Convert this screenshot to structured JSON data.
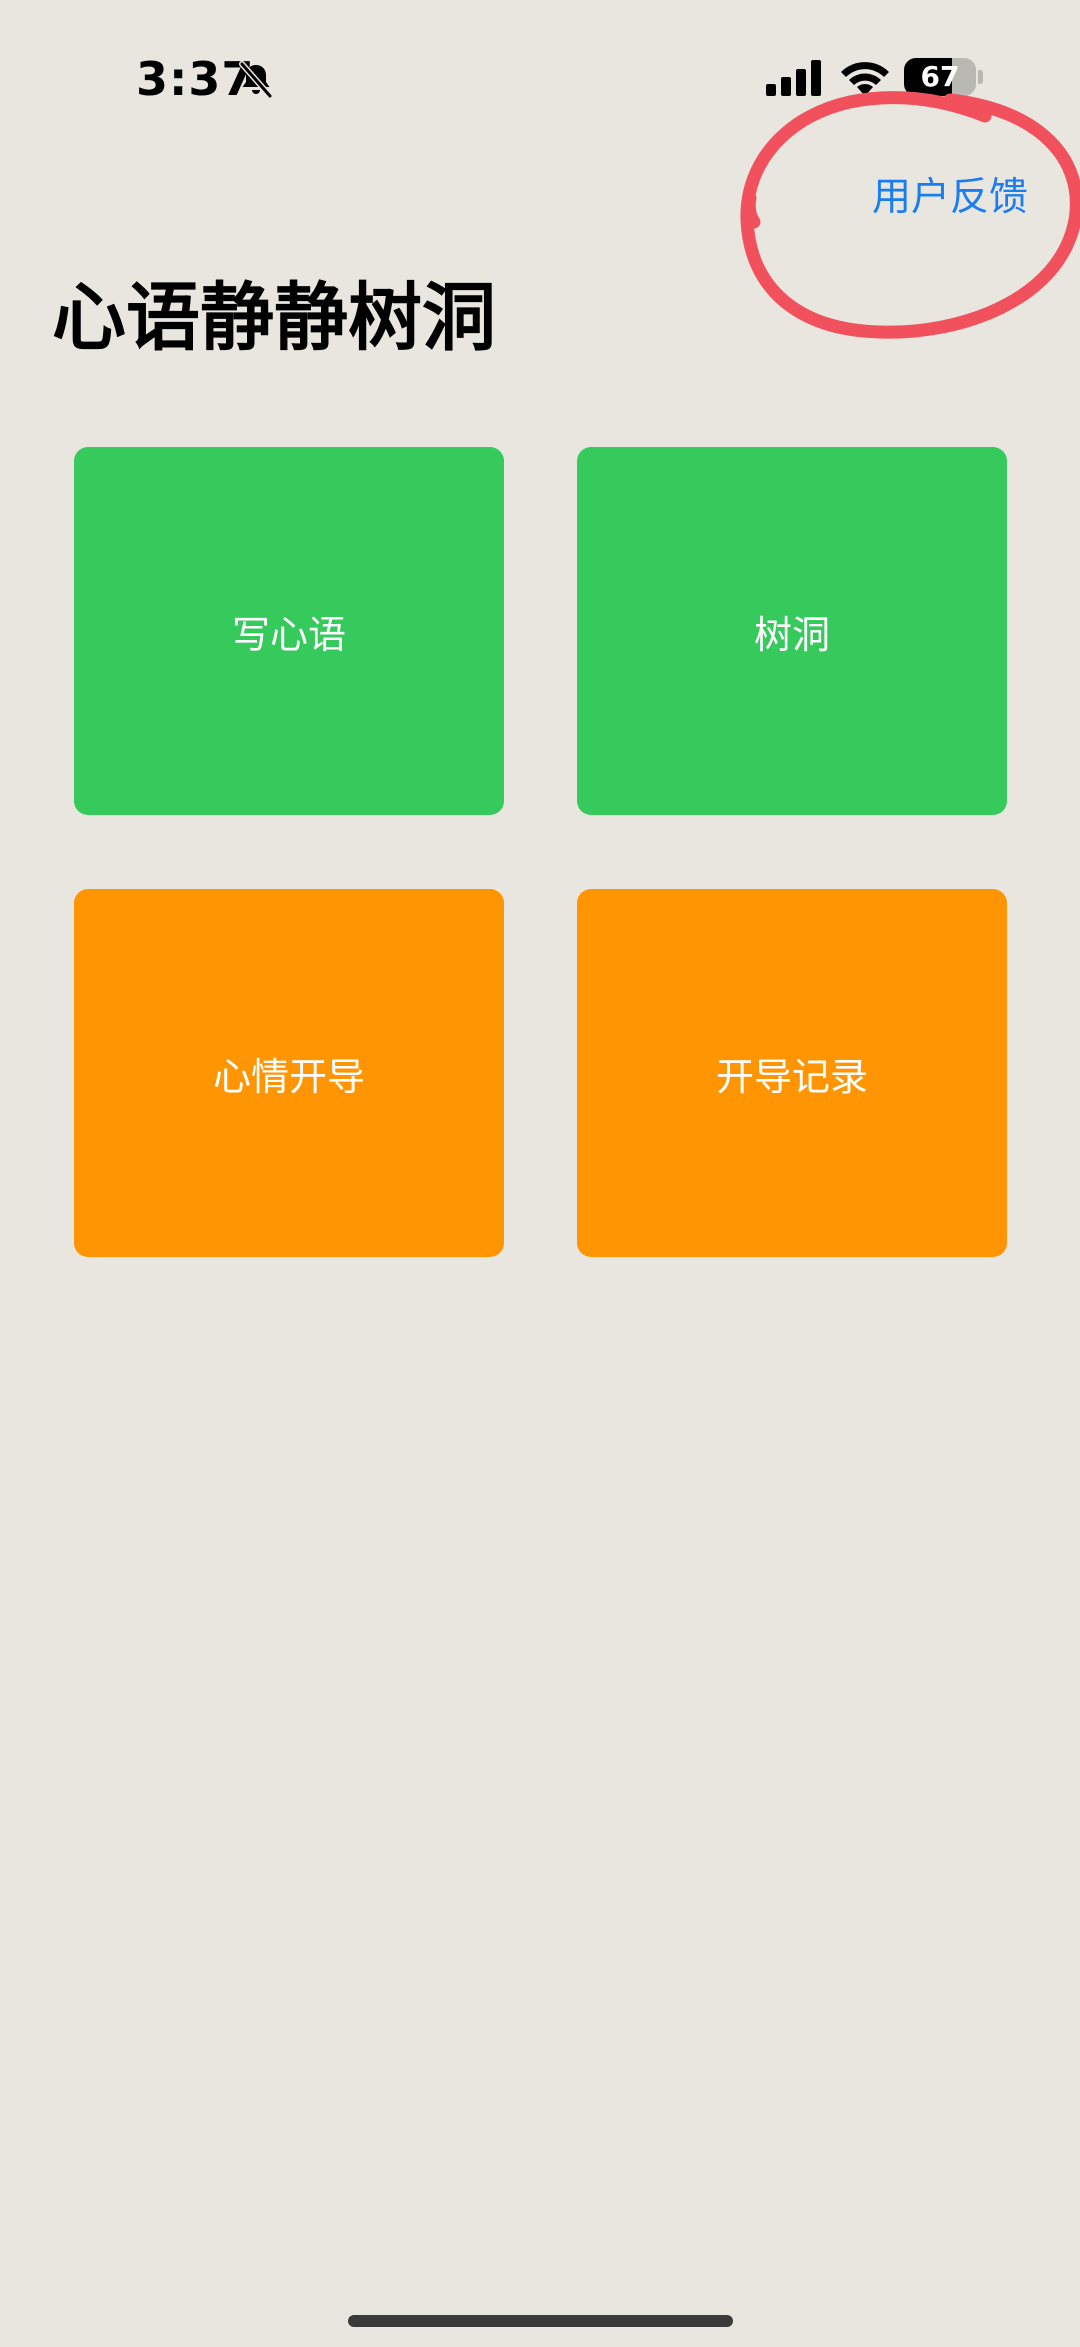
{
  "status_bar": {
    "time": "3:37",
    "battery_level": "67",
    "battery_fraction": 0.67,
    "icons": [
      "bell-slash-icon",
      "cellular-signal-icon",
      "wifi-icon",
      "battery-icon"
    ]
  },
  "header": {
    "feedback_label": "用户反馈",
    "title": "心语静静树洞"
  },
  "tiles": [
    {
      "label": "写心语",
      "color": "#36c95c"
    },
    {
      "label": "树洞",
      "color": "#36c95c"
    },
    {
      "label": "心情开导",
      "color": "#ff9503"
    },
    {
      "label": "开导记录",
      "color": "#ff9503"
    }
  ],
  "colors": {
    "background": "#e8e6df",
    "link": "#1a7ef0",
    "annotation": "#f0515c"
  }
}
